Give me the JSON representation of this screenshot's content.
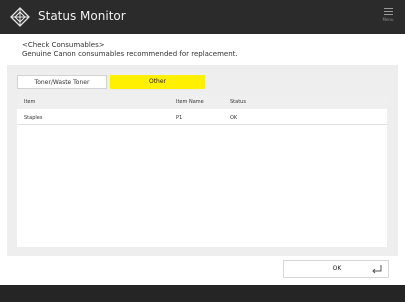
{
  "header": {
    "title": "Status Monitor",
    "menu_caption": "Menu",
    "icon": "diamond-logo-icon",
    "background": "#2b2b2b"
  },
  "instruction": {
    "heading": "<Check Consumables>",
    "text": "Genuine Canon consumables recommended for replacement."
  },
  "tabs": [
    {
      "label": "Toner/Waste Toner",
      "selected": false
    },
    {
      "label": "Other",
      "selected": true
    }
  ],
  "table": {
    "columns": [
      "Item",
      "Item Name",
      "Status"
    ],
    "rows": [
      {
        "item": "Staples",
        "item_name": "P1",
        "status": "OK"
      }
    ]
  },
  "footer": {
    "ok_label": "OK",
    "enter_icon": "enter-arrow-icon"
  },
  "colors": {
    "accent_tab": "#ffef00",
    "panel": "#eeeeee",
    "bottom_bar": "#252525"
  }
}
